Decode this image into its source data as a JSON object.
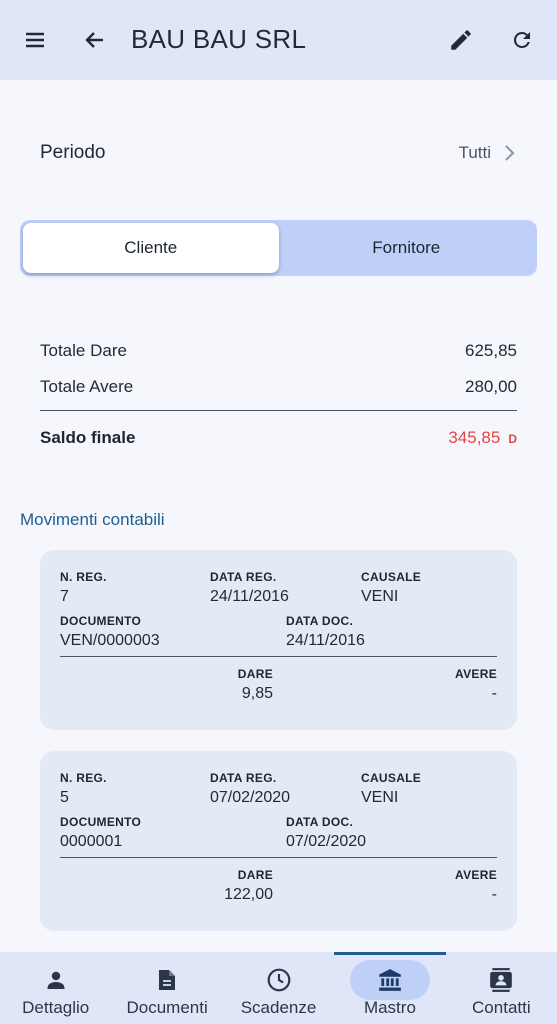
{
  "appbar": {
    "title": "BAU BAU SRL",
    "icons": [
      "menu-icon",
      "back-arrow-icon",
      "edit-pencil-icon",
      "refresh-icon"
    ]
  },
  "periodo": {
    "label": "Periodo",
    "value": "Tutti"
  },
  "segmented": {
    "options": [
      "Cliente",
      "Fornitore"
    ],
    "selected": "Cliente"
  },
  "totals": {
    "dare_label": "Totale Dare",
    "dare_value": "625,85",
    "avere_label": "Totale Avere",
    "avere_value": "280,00",
    "saldo_label": "Saldo finale",
    "saldo_value": "345,85",
    "saldo_flag": "D"
  },
  "movimenti": {
    "title": "Movimenti contabili",
    "headers": {
      "n_reg": "N. REG.",
      "data_reg": "DATA REG.",
      "causale": "CAUSALE",
      "documento": "DOCUMENTO",
      "data_doc": "DATA DOC.",
      "dare": "DARE",
      "avere": "AVERE"
    },
    "items": [
      {
        "n_reg": "7",
        "data_reg": "24/11/2016",
        "causale": "VENI",
        "documento": "VEN/0000003",
        "data_doc": "24/11/2016",
        "dare": "9,85",
        "avere": "-"
      },
      {
        "n_reg": "5",
        "data_reg": "07/02/2020",
        "causale": "VENI",
        "documento": "0000001",
        "data_doc": "07/02/2020",
        "dare": "122,00",
        "avere": "-"
      }
    ]
  },
  "bottomnav": {
    "items": [
      {
        "label": "Dettaglio",
        "icon": "person-icon"
      },
      {
        "label": "Documenti",
        "icon": "document-icon"
      },
      {
        "label": "Scadenze",
        "icon": "clock-icon"
      },
      {
        "label": "Mastro",
        "icon": "bank-icon"
      },
      {
        "label": "Contatti",
        "icon": "contacts-icon"
      }
    ],
    "active": "Mastro"
  },
  "colors": {
    "appbar_bg": "#e0e6f7",
    "accent": "#1e5e93",
    "saldo_red": "#e04848",
    "segment_bg": "#bfd0f8"
  }
}
